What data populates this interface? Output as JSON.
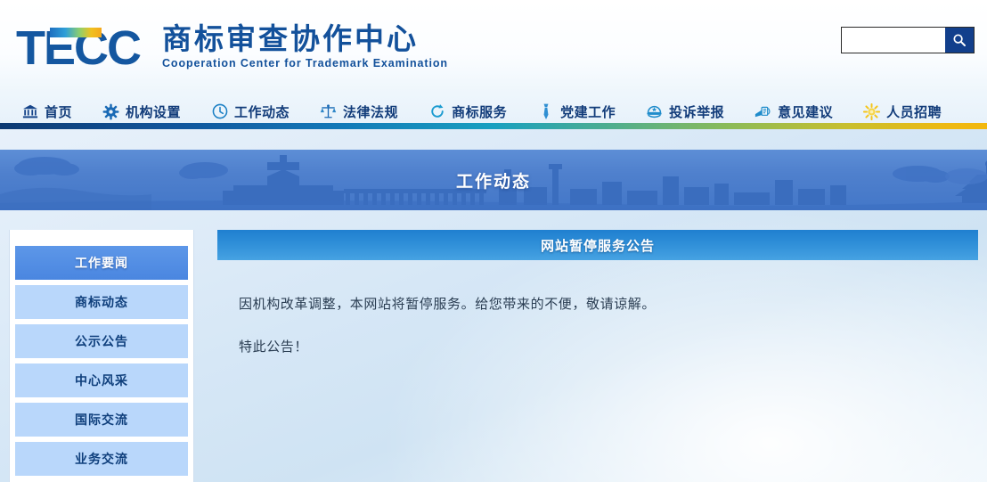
{
  "header": {
    "logo_text": "TECC",
    "brand_cn": "商标审查协作中心",
    "brand_en": "Cooperation Center for Trademark Examination",
    "search": {
      "value": "",
      "placeholder": "",
      "button_icon": "search-icon"
    }
  },
  "nav": {
    "items": [
      {
        "label": "首页",
        "icon": "bank-building-icon"
      },
      {
        "label": "机构设置",
        "icon": "gear-icon"
      },
      {
        "label": "工作动态",
        "icon": "clock-icon"
      },
      {
        "label": "法律法规",
        "icon": "scales-of-justice-icon"
      },
      {
        "label": "商标服务",
        "icon": "refresh-arrow-icon"
      },
      {
        "label": "党建工作",
        "icon": "necktie-icon"
      },
      {
        "label": "投诉举报",
        "icon": "police-cap-icon"
      },
      {
        "label": "意见建议",
        "icon": "mailbox-icon"
      },
      {
        "label": "人员招聘",
        "icon": "sun-burst-icon"
      }
    ]
  },
  "banner": {
    "title": "工作动态"
  },
  "sidebar": {
    "items": [
      {
        "label": "工作要闻",
        "active": true
      },
      {
        "label": "商标动态",
        "active": false
      },
      {
        "label": "公示公告",
        "active": false
      },
      {
        "label": "中心风采",
        "active": false
      },
      {
        "label": "国际交流",
        "active": false
      },
      {
        "label": "业务交流",
        "active": false
      }
    ]
  },
  "article": {
    "title": "网站暂停服务公告",
    "paragraphs": [
      "因机构改革调整，本网站将暂停服务。给您带来的不便，敬请谅解。",
      "特此公告！"
    ]
  },
  "colors": {
    "brand_blue": "#13519b",
    "nav_text": "#123c7a",
    "accent_blue": "#1f7fd0",
    "sidebar_active": "#4a86e0",
    "sidebar_item": "#b9d7fb",
    "search_button": "#123f8c",
    "banner_blue": "#4f80cd"
  }
}
